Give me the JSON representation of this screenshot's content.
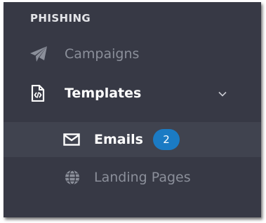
{
  "sidebar": {
    "section_title": "PHISHING",
    "items": [
      {
        "label": "Campaigns",
        "icon": "paper-plane-icon",
        "state": "inactive"
      },
      {
        "label": "Templates",
        "icon": "code-file-icon",
        "state": "active-parent",
        "expanded": true
      },
      {
        "label": "Emails",
        "icon": "envelope-icon",
        "state": "selected",
        "badge": "2"
      },
      {
        "label": "Landing Pages",
        "icon": "globe-icon",
        "state": "inactive"
      }
    ]
  },
  "colors": {
    "background": "#373945",
    "selected_row": "#40434f",
    "badge": "#1b7bc4",
    "active_text": "#ffffff",
    "inactive_text": "#8b8f9a"
  }
}
